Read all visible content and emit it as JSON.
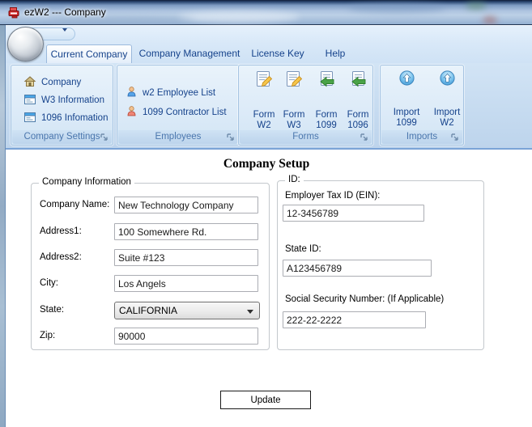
{
  "window": {
    "title": "ezW2 --- Company"
  },
  "colors": {
    "accent_text": "#15428b",
    "app_icon_red": "#d12b2b",
    "ribbon_caption": "#4a76ad"
  },
  "ribbon": {
    "tabs": [
      {
        "label": "Current Company",
        "selected": true
      },
      {
        "label": "Company Management",
        "selected": false
      },
      {
        "label": "License Key",
        "selected": false
      },
      {
        "label": "Help",
        "selected": false
      }
    ],
    "company_settings": {
      "title": "Company Settings",
      "items": [
        {
          "label": "Company",
          "icon": "house-icon"
        },
        {
          "label": "W3 Information",
          "icon": "form-grid-icon"
        },
        {
          "label": "1096 Infomation",
          "icon": "form-grid-icon"
        }
      ]
    },
    "employees": {
      "title": "Employees",
      "items": [
        {
          "label": "w2 Employee List",
          "icon": "person-blue-icon"
        },
        {
          "label": "1099 Contractor List",
          "icon": "person-red-icon"
        }
      ]
    },
    "forms": {
      "title": "Forms",
      "items": [
        {
          "line1": "Form",
          "line2": "W2",
          "icon": "form-edit-icon"
        },
        {
          "line1": "Form",
          "line2": "W3",
          "icon": "form-edit-icon"
        },
        {
          "line1": "Form",
          "line2": "1099",
          "icon": "form-arrow-icon"
        },
        {
          "line1": "Form",
          "line2": "1096",
          "icon": "form-arrow-icon"
        }
      ]
    },
    "imports": {
      "title": "Imports",
      "items": [
        {
          "line1": "Import",
          "line2": "1099",
          "icon": "import-up-icon"
        },
        {
          "line1": "Import",
          "line2": "W2",
          "icon": "import-up-icon"
        }
      ]
    }
  },
  "form": {
    "heading": "Company Setup",
    "company_info": {
      "legend": "Company Information",
      "company_name": {
        "label": "Company Name:",
        "value": "New Technology Company"
      },
      "address1": {
        "label": "Address1:",
        "value": "100 Somewhere Rd."
      },
      "address2": {
        "label": "Address2:",
        "value": "Suite #123"
      },
      "city": {
        "label": "City:",
        "value": "Los Angels"
      },
      "state": {
        "label": "State:",
        "value": "CALIFORNIA"
      },
      "zip": {
        "label": "Zip:",
        "value": "90000"
      }
    },
    "ids": {
      "legend": "ID:",
      "ein": {
        "label": "Employer Tax ID (EIN):",
        "value": "12-3456789"
      },
      "state_id": {
        "label": "State ID:",
        "value": "A123456789"
      },
      "ssn": {
        "label": "Social Security Number: (If Applicable)",
        "value": "222-22-2222"
      }
    },
    "update_button": "Update"
  }
}
